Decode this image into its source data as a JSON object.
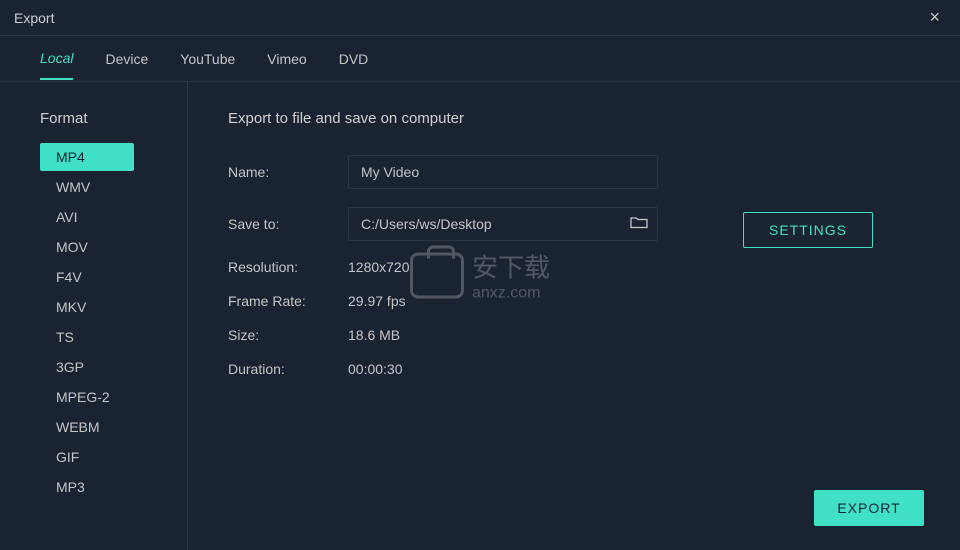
{
  "titlebar": {
    "title": "Export",
    "close": "×"
  },
  "tabs": [
    {
      "label": "Local",
      "active": true
    },
    {
      "label": "Device",
      "active": false
    },
    {
      "label": "YouTube",
      "active": false
    },
    {
      "label": "Vimeo",
      "active": false
    },
    {
      "label": "DVD",
      "active": false
    }
  ],
  "sidebar": {
    "heading": "Format",
    "formats": [
      {
        "label": "MP4",
        "active": true
      },
      {
        "label": "WMV",
        "active": false
      },
      {
        "label": "AVI",
        "active": false
      },
      {
        "label": "MOV",
        "active": false
      },
      {
        "label": "F4V",
        "active": false
      },
      {
        "label": "MKV",
        "active": false
      },
      {
        "label": "TS",
        "active": false
      },
      {
        "label": "3GP",
        "active": false
      },
      {
        "label": "MPEG-2",
        "active": false
      },
      {
        "label": "WEBM",
        "active": false
      },
      {
        "label": "GIF",
        "active": false
      },
      {
        "label": "MP3",
        "active": false
      }
    ]
  },
  "main": {
    "heading": "Export to file and save on computer",
    "fields": {
      "name_label": "Name:",
      "name_value": "My Video",
      "saveto_label": "Save to:",
      "saveto_value": "C:/Users/ws/Desktop",
      "resolution_label": "Resolution:",
      "resolution_value": "1280x720",
      "framerate_label": "Frame Rate:",
      "framerate_value": "29.97 fps",
      "size_label": "Size:",
      "size_value": "18.6 MB",
      "duration_label": "Duration:",
      "duration_value": "00:00:30"
    },
    "settings_btn": "SETTINGS",
    "export_btn": "EXPORT"
  },
  "watermark": {
    "cn": "安下载",
    "en": "anxz.com"
  }
}
